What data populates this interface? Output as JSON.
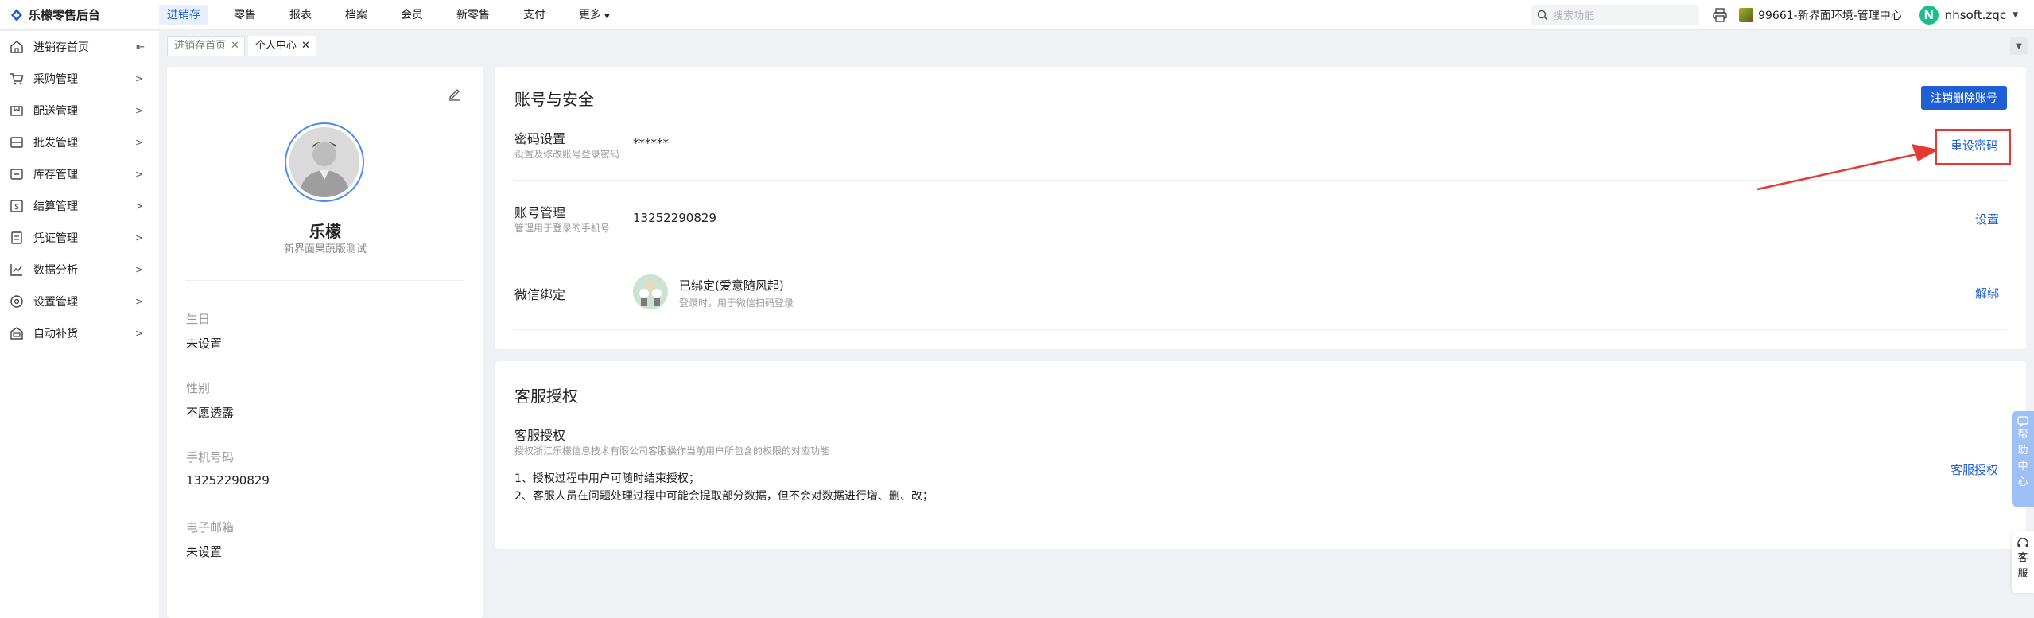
{
  "app": {
    "brand": "乐檬零售后台",
    "brand_logo_icon": "lemon-logo-icon",
    "accent_color": "#1f5fd6"
  },
  "topnav": {
    "items": [
      {
        "label": "进销存",
        "active": true
      },
      {
        "label": "零售"
      },
      {
        "label": "报表"
      },
      {
        "label": "档案"
      },
      {
        "label": "会员"
      },
      {
        "label": "新零售"
      },
      {
        "label": "支付"
      },
      {
        "label": "更多"
      }
    ]
  },
  "topright": {
    "search_placeholder": "搜索功能",
    "store": "99661-新界面环境-管理中心",
    "user_initial": "N",
    "user_name": "nhsoft.zqc"
  },
  "sidebar": {
    "items": [
      {
        "label": "进销存首页",
        "icon": "home-icon"
      },
      {
        "label": "采购管理",
        "icon": "cart-icon"
      },
      {
        "label": "配送管理",
        "icon": "delivery-box-icon"
      },
      {
        "label": "批发管理",
        "icon": "wholesale-icon"
      },
      {
        "label": "库存管理",
        "icon": "inventory-icon"
      },
      {
        "label": "结算管理",
        "icon": "settlement-icon"
      },
      {
        "label": "凭证管理",
        "icon": "voucher-icon"
      },
      {
        "label": "数据分析",
        "icon": "chart-icon"
      },
      {
        "label": "设置管理",
        "icon": "settings-icon"
      },
      {
        "label": "自动补货",
        "icon": "replenish-icon"
      }
    ]
  },
  "tabs": [
    {
      "label": "进销存首页",
      "active": false
    },
    {
      "label": "个人中心",
      "active": true
    }
  ],
  "profile": {
    "name": "乐檬",
    "subtitle": "新界面果蔬版测试",
    "fields": [
      {
        "label": "生日",
        "value": "未设置"
      },
      {
        "label": "性别",
        "value": "不愿透露"
      },
      {
        "label": "手机号码",
        "value": "13252290829"
      },
      {
        "label": "电子邮箱",
        "value": "未设置"
      }
    ]
  },
  "account": {
    "title": "账号与安全",
    "deregister_button": "注销删除账号",
    "password": {
      "label": "密码设置",
      "desc": "设置及修改账号登录密码",
      "value": "******",
      "action": "重设密码"
    },
    "account_mgmt": {
      "label": "账号管理",
      "desc": "管理用于登录的手机号",
      "value": "13252290829",
      "action": "设置"
    },
    "wechat": {
      "label": "微信绑定",
      "status": "已绑定(爱意随风起)",
      "desc": "登录时，用于微信扫码登录",
      "action": "解绑"
    }
  },
  "service": {
    "title": "客服授权",
    "label": "客服授权",
    "desc": "授权浙江乐檬信息技术有限公司客服操作当前用户所包含的权限的对应功能",
    "line1": "1、授权过程中用户可随时结束授权；",
    "line2": "2、客服人员在问题处理过程中可能会提取部分数据，但不会对数据进行增、删、改；",
    "action": "客服授权"
  },
  "floats": {
    "help": [
      "帮",
      "助",
      "中",
      "心"
    ],
    "kefu": [
      "客",
      "服"
    ]
  }
}
